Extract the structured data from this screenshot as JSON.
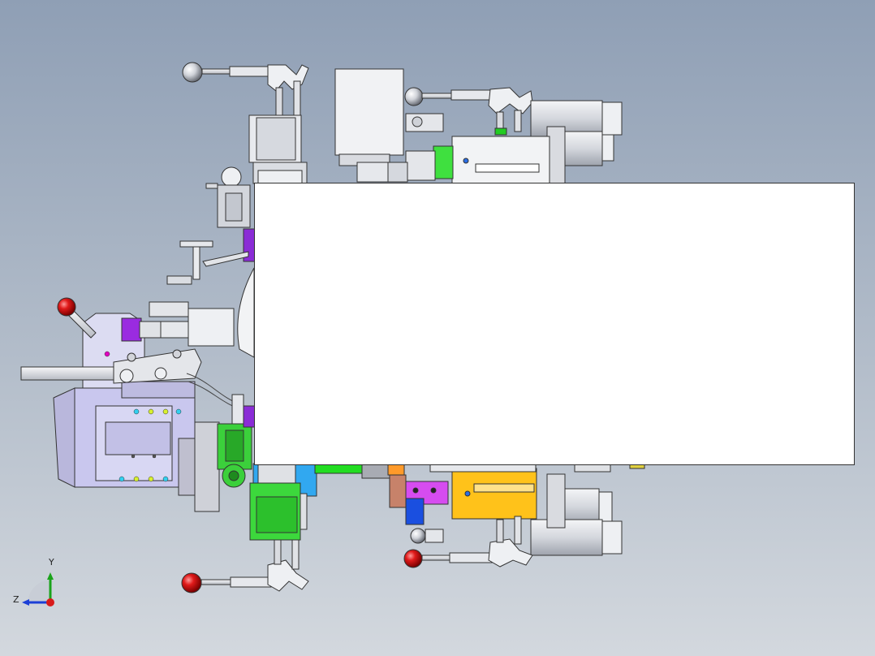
{
  "viewport": {
    "background_top": "#8f9fb5",
    "background_bottom": "#d3d8de"
  },
  "triad": {
    "y_label": "Y",
    "z_label": "Z",
    "y_color": "#1aa31a",
    "z_color": "#1c3fd6",
    "x_color": "#d81a1a"
  },
  "colors": {
    "part_gray": "#d9dbe0",
    "part_lavender": "#c9c7ee",
    "part_green": "#22dd22",
    "part_orange": "#ffc21a",
    "part_purple": "#9a2be0",
    "part_magenta": "#d64cf0",
    "part_blue": "#1a5fe0",
    "part_cyan": "#31a8f0",
    "knob_red": "#d41515"
  }
}
